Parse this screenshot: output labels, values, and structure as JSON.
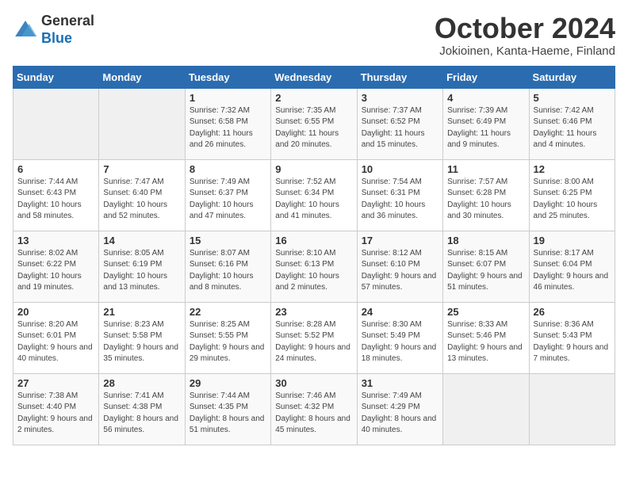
{
  "header": {
    "logo_general": "General",
    "logo_blue": "Blue",
    "month_title": "October 2024",
    "location": "Jokioinen, Kanta-Haeme, Finland"
  },
  "weekdays": [
    "Sunday",
    "Monday",
    "Tuesday",
    "Wednesday",
    "Thursday",
    "Friday",
    "Saturday"
  ],
  "weeks": [
    [
      {
        "day": "",
        "sunrise": "",
        "sunset": "",
        "daylight": ""
      },
      {
        "day": "",
        "sunrise": "",
        "sunset": "",
        "daylight": ""
      },
      {
        "day": "1",
        "sunrise": "Sunrise: 7:32 AM",
        "sunset": "Sunset: 6:58 PM",
        "daylight": "Daylight: 11 hours and 26 minutes."
      },
      {
        "day": "2",
        "sunrise": "Sunrise: 7:35 AM",
        "sunset": "Sunset: 6:55 PM",
        "daylight": "Daylight: 11 hours and 20 minutes."
      },
      {
        "day": "3",
        "sunrise": "Sunrise: 7:37 AM",
        "sunset": "Sunset: 6:52 PM",
        "daylight": "Daylight: 11 hours and 15 minutes."
      },
      {
        "day": "4",
        "sunrise": "Sunrise: 7:39 AM",
        "sunset": "Sunset: 6:49 PM",
        "daylight": "Daylight: 11 hours and 9 minutes."
      },
      {
        "day": "5",
        "sunrise": "Sunrise: 7:42 AM",
        "sunset": "Sunset: 6:46 PM",
        "daylight": "Daylight: 11 hours and 4 minutes."
      }
    ],
    [
      {
        "day": "6",
        "sunrise": "Sunrise: 7:44 AM",
        "sunset": "Sunset: 6:43 PM",
        "daylight": "Daylight: 10 hours and 58 minutes."
      },
      {
        "day": "7",
        "sunrise": "Sunrise: 7:47 AM",
        "sunset": "Sunset: 6:40 PM",
        "daylight": "Daylight: 10 hours and 52 minutes."
      },
      {
        "day": "8",
        "sunrise": "Sunrise: 7:49 AM",
        "sunset": "Sunset: 6:37 PM",
        "daylight": "Daylight: 10 hours and 47 minutes."
      },
      {
        "day": "9",
        "sunrise": "Sunrise: 7:52 AM",
        "sunset": "Sunset: 6:34 PM",
        "daylight": "Daylight: 10 hours and 41 minutes."
      },
      {
        "day": "10",
        "sunrise": "Sunrise: 7:54 AM",
        "sunset": "Sunset: 6:31 PM",
        "daylight": "Daylight: 10 hours and 36 minutes."
      },
      {
        "day": "11",
        "sunrise": "Sunrise: 7:57 AM",
        "sunset": "Sunset: 6:28 PM",
        "daylight": "Daylight: 10 hours and 30 minutes."
      },
      {
        "day": "12",
        "sunrise": "Sunrise: 8:00 AM",
        "sunset": "Sunset: 6:25 PM",
        "daylight": "Daylight: 10 hours and 25 minutes."
      }
    ],
    [
      {
        "day": "13",
        "sunrise": "Sunrise: 8:02 AM",
        "sunset": "Sunset: 6:22 PM",
        "daylight": "Daylight: 10 hours and 19 minutes."
      },
      {
        "day": "14",
        "sunrise": "Sunrise: 8:05 AM",
        "sunset": "Sunset: 6:19 PM",
        "daylight": "Daylight: 10 hours and 13 minutes."
      },
      {
        "day": "15",
        "sunrise": "Sunrise: 8:07 AM",
        "sunset": "Sunset: 6:16 PM",
        "daylight": "Daylight: 10 hours and 8 minutes."
      },
      {
        "day": "16",
        "sunrise": "Sunrise: 8:10 AM",
        "sunset": "Sunset: 6:13 PM",
        "daylight": "Daylight: 10 hours and 2 minutes."
      },
      {
        "day": "17",
        "sunrise": "Sunrise: 8:12 AM",
        "sunset": "Sunset: 6:10 PM",
        "daylight": "Daylight: 9 hours and 57 minutes."
      },
      {
        "day": "18",
        "sunrise": "Sunrise: 8:15 AM",
        "sunset": "Sunset: 6:07 PM",
        "daylight": "Daylight: 9 hours and 51 minutes."
      },
      {
        "day": "19",
        "sunrise": "Sunrise: 8:17 AM",
        "sunset": "Sunset: 6:04 PM",
        "daylight": "Daylight: 9 hours and 46 minutes."
      }
    ],
    [
      {
        "day": "20",
        "sunrise": "Sunrise: 8:20 AM",
        "sunset": "Sunset: 6:01 PM",
        "daylight": "Daylight: 9 hours and 40 minutes."
      },
      {
        "day": "21",
        "sunrise": "Sunrise: 8:23 AM",
        "sunset": "Sunset: 5:58 PM",
        "daylight": "Daylight: 9 hours and 35 minutes."
      },
      {
        "day": "22",
        "sunrise": "Sunrise: 8:25 AM",
        "sunset": "Sunset: 5:55 PM",
        "daylight": "Daylight: 9 hours and 29 minutes."
      },
      {
        "day": "23",
        "sunrise": "Sunrise: 8:28 AM",
        "sunset": "Sunset: 5:52 PM",
        "daylight": "Daylight: 9 hours and 24 minutes."
      },
      {
        "day": "24",
        "sunrise": "Sunrise: 8:30 AM",
        "sunset": "Sunset: 5:49 PM",
        "daylight": "Daylight: 9 hours and 18 minutes."
      },
      {
        "day": "25",
        "sunrise": "Sunrise: 8:33 AM",
        "sunset": "Sunset: 5:46 PM",
        "daylight": "Daylight: 9 hours and 13 minutes."
      },
      {
        "day": "26",
        "sunrise": "Sunrise: 8:36 AM",
        "sunset": "Sunset: 5:43 PM",
        "daylight": "Daylight: 9 hours and 7 minutes."
      }
    ],
    [
      {
        "day": "27",
        "sunrise": "Sunrise: 7:38 AM",
        "sunset": "Sunset: 4:40 PM",
        "daylight": "Daylight: 9 hours and 2 minutes."
      },
      {
        "day": "28",
        "sunrise": "Sunrise: 7:41 AM",
        "sunset": "Sunset: 4:38 PM",
        "daylight": "Daylight: 8 hours and 56 minutes."
      },
      {
        "day": "29",
        "sunrise": "Sunrise: 7:44 AM",
        "sunset": "Sunset: 4:35 PM",
        "daylight": "Daylight: 8 hours and 51 minutes."
      },
      {
        "day": "30",
        "sunrise": "Sunrise: 7:46 AM",
        "sunset": "Sunset: 4:32 PM",
        "daylight": "Daylight: 8 hours and 45 minutes."
      },
      {
        "day": "31",
        "sunrise": "Sunrise: 7:49 AM",
        "sunset": "Sunset: 4:29 PM",
        "daylight": "Daylight: 8 hours and 40 minutes."
      },
      {
        "day": "",
        "sunrise": "",
        "sunset": "",
        "daylight": ""
      },
      {
        "day": "",
        "sunrise": "",
        "sunset": "",
        "daylight": ""
      }
    ]
  ]
}
